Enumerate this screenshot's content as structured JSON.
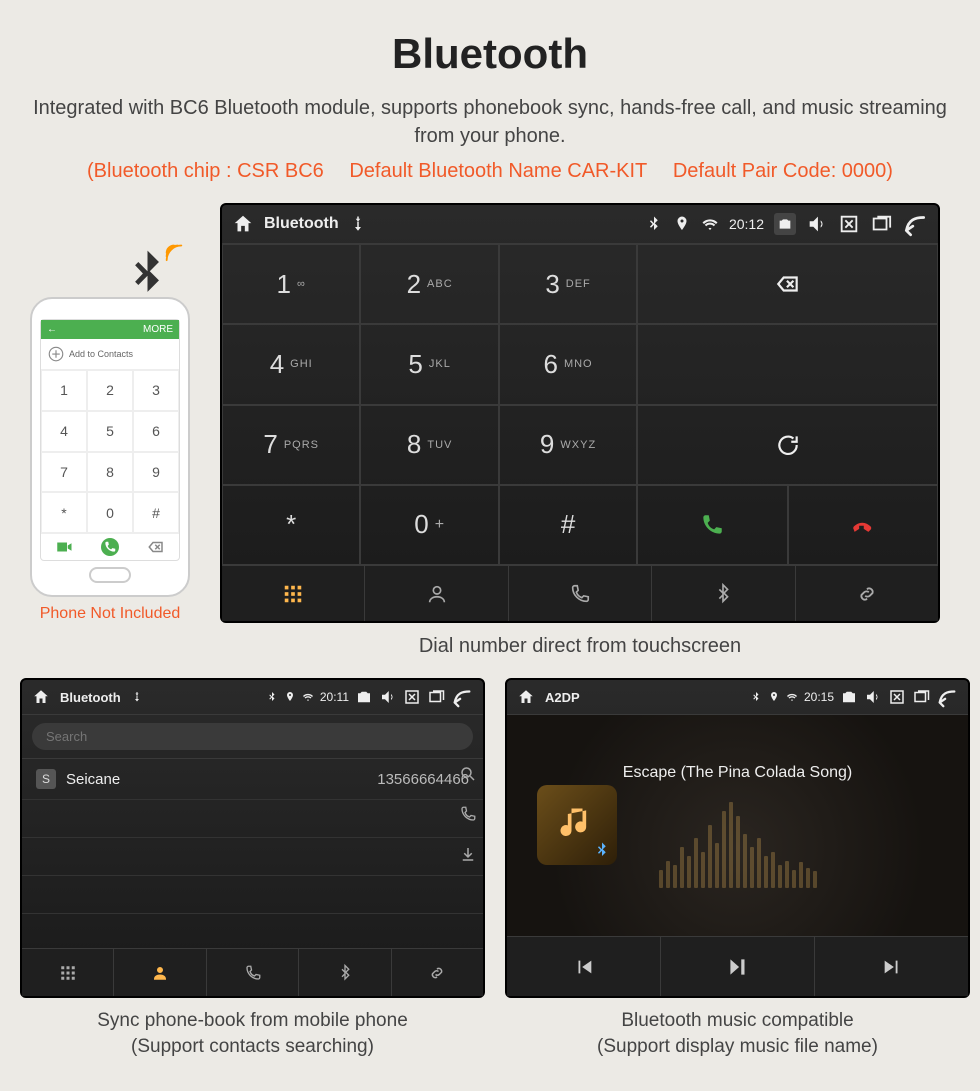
{
  "page": {
    "title": "Bluetooth",
    "subtitle": "Integrated with BC6 Bluetooth module, supports phonebook sync, hands-free call, and music streaming from your phone.",
    "spec_chip": "(Bluetooth chip : CSR BC6",
    "spec_name": "Default Bluetooth Name CAR-KIT",
    "spec_pair": "Default Pair Code: 0000)"
  },
  "phone": {
    "top_left": "←",
    "top_right": "MORE",
    "add_contacts": "Add to Contacts",
    "not_included": "Phone Not Included",
    "keys": [
      "1",
      "2",
      "3",
      "4",
      "5",
      "6",
      "7",
      "8",
      "9",
      "*",
      "0",
      "#"
    ]
  },
  "dialer": {
    "status": {
      "app": "Bluetooth",
      "time": "20:12"
    },
    "keys": [
      {
        "n": "1",
        "s": "∞"
      },
      {
        "n": "2",
        "s": "ABC"
      },
      {
        "n": "3",
        "s": "DEF"
      },
      {
        "n": "4",
        "s": "GHI"
      },
      {
        "n": "5",
        "s": "JKL"
      },
      {
        "n": "6",
        "s": "MNO"
      },
      {
        "n": "7",
        "s": "PQRS"
      },
      {
        "n": "8",
        "s": "TUV"
      },
      {
        "n": "9",
        "s": "WXYZ"
      },
      {
        "n": "*",
        "s": ""
      },
      {
        "n": "0",
        "s": "+"
      },
      {
        "n": "#",
        "s": ""
      }
    ],
    "caption": "Dial number direct from touchscreen"
  },
  "contacts": {
    "status": {
      "app": "Bluetooth",
      "time": "20:11"
    },
    "search_placeholder": "Search",
    "items": [
      {
        "badge": "S",
        "name": "Seicane",
        "number": "13566664466"
      }
    ],
    "caption_l1": "Sync phone-book from mobile phone",
    "caption_l2": "(Support contacts searching)"
  },
  "a2dp": {
    "status": {
      "app": "A2DP",
      "time": "20:15"
    },
    "song": "Escape (The Pina Colada Song)",
    "caption_l1": "Bluetooth music compatible",
    "caption_l2": "(Support display music file name)"
  }
}
